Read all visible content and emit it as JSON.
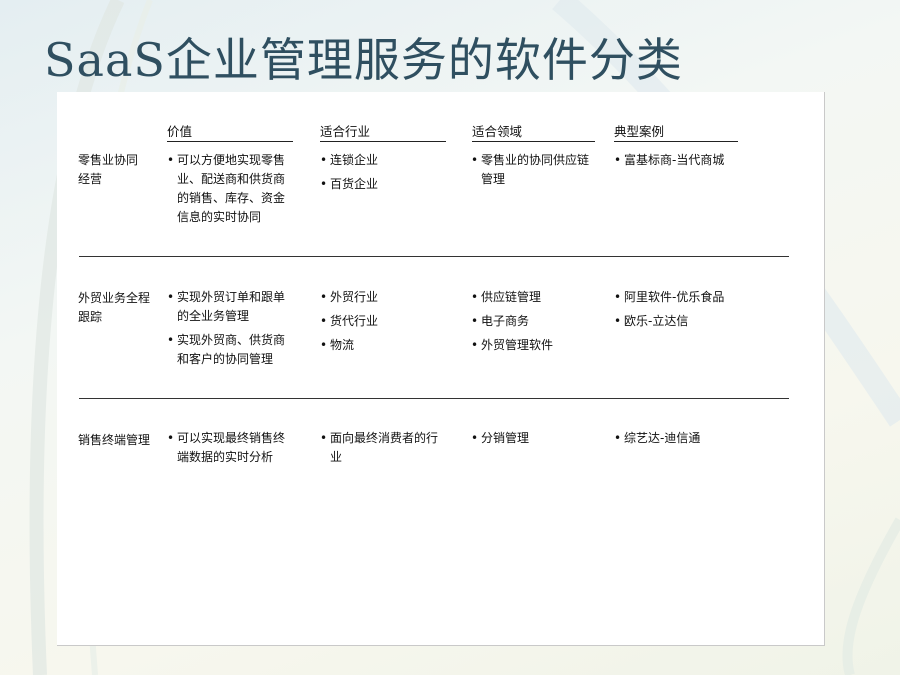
{
  "title": "SaaS企业管理服务的软件分类",
  "headers": [
    "价值",
    "适合行业",
    "适合领域",
    "典型案例"
  ],
  "rows": [
    {
      "label": "零售业协同经营",
      "value": [
        "可以方便地实现零售业、配送商和供货商的销售、库存、资金信息的实时协同"
      ],
      "industry": [
        "连锁企业",
        "百货企业"
      ],
      "domain": [
        "零售业的协同供应链管理"
      ],
      "case": [
        "富基标商-当代商城"
      ]
    },
    {
      "label": "外贸业务全程跟踪",
      "value": [
        "实现外贸订单和跟单的全业务管理",
        "实现外贸商、供货商和客户的协同管理"
      ],
      "industry": [
        "外贸行业",
        "货代行业",
        "物流"
      ],
      "domain": [
        "供应链管理",
        "电子商务",
        "外贸管理软件"
      ],
      "case": [
        "阿里软件-优乐食品",
        "欧乐-立达信"
      ]
    },
    {
      "label": "销售终端管理",
      "value": [
        "可以实现最终销售终端数据的实时分析"
      ],
      "industry": [
        "面向最终消费者的行业"
      ],
      "domain": [
        "分销管理"
      ],
      "case": [
        "综艺达-迪信通"
      ]
    }
  ]
}
